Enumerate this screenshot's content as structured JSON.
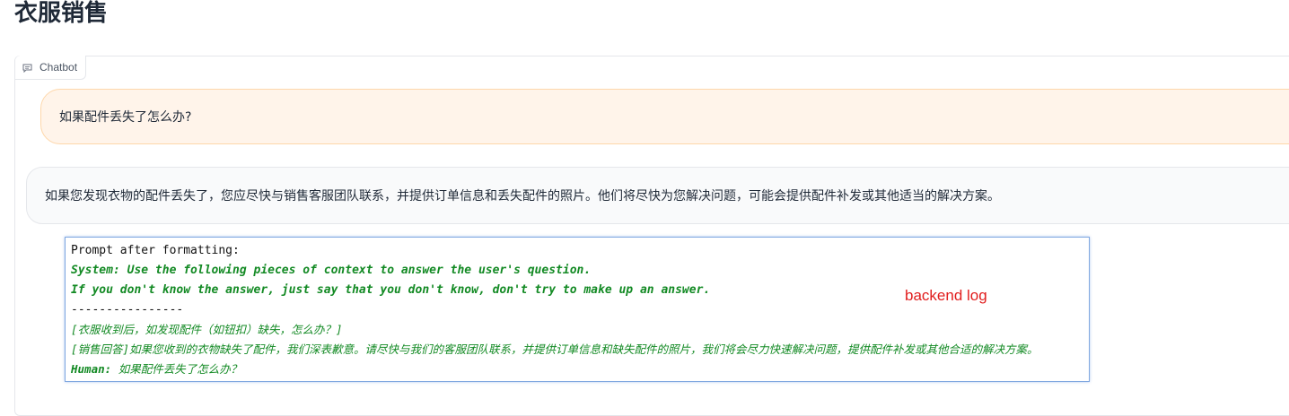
{
  "page": {
    "title": "衣服销售"
  },
  "chatbot": {
    "label": "Chatbot",
    "label_icon": "chat-bubble-icon",
    "messages": [
      {
        "role": "user",
        "text": "如果配件丢失了怎么办?"
      },
      {
        "role": "bot",
        "text": "如果您发现衣物的配件丢失了，您应尽快与销售客服团队联系，并提供订单信息和丢失配件的照片。他们将尽快为您解决问题，可能会提供配件补发或其他适当的解决方案。"
      }
    ]
  },
  "log": {
    "lines": [
      "Prompt after formatting:",
      "System: Use the following pieces of context to answer the user's question.",
      "If you don't know the answer, just say that you don't know, don't try to make up an answer.",
      "----------------",
      "[衣服收到后，如发现配件（如钮扣）缺失，怎么办？]",
      "[销售回答]如果您收到的衣物缺失了配件，我们深表歉意。请尽快与我们的客服团队联系，并提供订单信息和缺失配件的照片，我们将会尽力快速解决问题，提供配件补发或其他合适的解决方案。",
      "如果配件丢失了怎么办？"
    ],
    "human_prefix": "Human:",
    "annotation": "backend log"
  },
  "colors": {
    "user_bubble_bg": "#fff4ea",
    "user_bubble_border": "#fed7aa",
    "bot_bubble_bg": "#f9fafb",
    "log_green": "#138a24",
    "annotation_red": "#e11d1d",
    "log_border": "#7fa7e0"
  }
}
